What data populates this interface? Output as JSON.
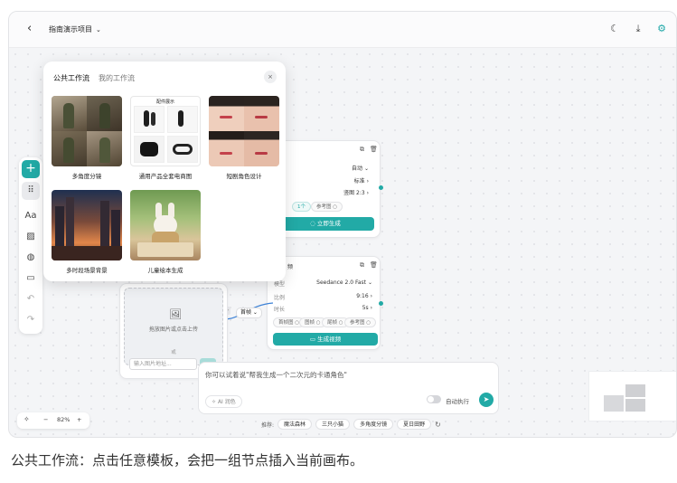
{
  "topbar": {
    "back_icon": "chevron-left-icon",
    "project_title": "指南演示项目",
    "project_caret": "chevron-down-icon",
    "icons": [
      "moon-icon",
      "download-icon",
      "gear-icon"
    ]
  },
  "toolbar": {
    "items": [
      "plus-icon",
      "grid-icon",
      "text-icon",
      "image-icon",
      "palette-icon",
      "video-icon",
      "undo-icon",
      "redo-icon"
    ],
    "text_tool": "Aa"
  },
  "panel": {
    "tabs": [
      "公共工作流",
      "我的工作流"
    ],
    "close": "×",
    "cards": [
      {
        "label": "多角度分镜"
      },
      {
        "label": "通用产品全套电商图",
        "inner_title": "配件展示"
      },
      {
        "label": "短剧角色设计"
      },
      {
        "label": "多时段场景背景"
      },
      {
        "label": "儿童绘本生成"
      }
    ]
  },
  "image_node": {
    "rows": [
      {
        "value": "自动",
        "suffix": "⌄"
      },
      {
        "value": "标准",
        "suffix": "›"
      },
      {
        "value": "竖图 2:3",
        "suffix": "›"
      }
    ],
    "count_chip": "1个",
    "ref_chip": "参考图 ○",
    "button": "立即生成"
  },
  "video_node": {
    "title": "频",
    "rows": [
      {
        "label": "模型",
        "value": "Seedance 2.0 Fast",
        "suffix": "⌄"
      },
      {
        "label": "比例",
        "value": "9:16",
        "suffix": "›"
      },
      {
        "label": "时长",
        "value": "5s",
        "suffix": "›"
      }
    ],
    "chips": [
      "首帧图 ○",
      "图帧 ○",
      "尾帧 ○",
      "参考图 ○"
    ],
    "button": "生成视频"
  },
  "upload_node": {
    "hint": "拖放图片或点击上传",
    "or": "或",
    "url_placeholder": "输入图片地址...",
    "connector_label": "首帧"
  },
  "chat": {
    "placeholder": "你可以试着说\"帮我生成一个二次元的卡通角色\"",
    "ai_button": "AI 润色",
    "auto_label": "自动执行"
  },
  "suggestions": {
    "label": "推荐:",
    "tags": [
      "魔法森林",
      "三只小猫",
      "多角度分镜",
      "夏日田野"
    ]
  },
  "zoom": {
    "level": "82%",
    "minus": "−",
    "plus": "+"
  },
  "caption": "公共工作流：点击任意模板，会把一组节点插入当前画布。",
  "colors": {
    "accent": "#22aaa6",
    "canvas": "#f4f5f7"
  }
}
